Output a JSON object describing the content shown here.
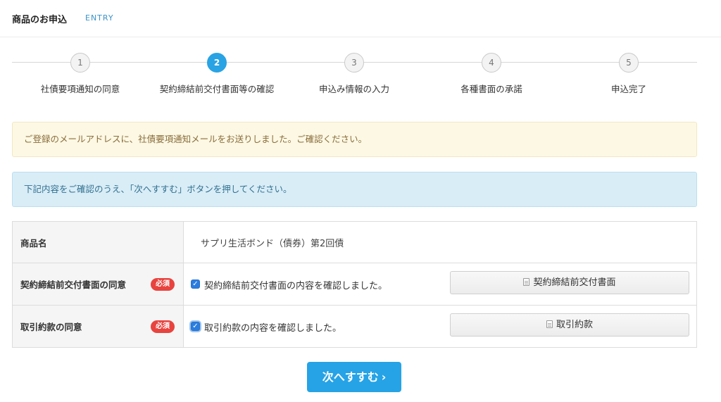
{
  "header": {
    "title": "商品のお申込",
    "subtitle": "ENTRY"
  },
  "steps": [
    {
      "number": "1",
      "label": "社債要項通知の同意",
      "state": "done"
    },
    {
      "number": "2",
      "label": "契約締結前交付書面等の確認",
      "state": "active"
    },
    {
      "number": "3",
      "label": "申込み情報の入力",
      "state": "pending"
    },
    {
      "number": "4",
      "label": "各種書面の承諾",
      "state": "pending"
    },
    {
      "number": "5",
      "label": "申込完了",
      "state": "pending"
    }
  ],
  "alerts": {
    "warning": "ご登録のメールアドレスに、社債要項通知メールをお送りしました。ご確認ください。",
    "info": "下記内容をご確認のうえ、「次へすすむ」ボタンを押してください。"
  },
  "form": {
    "product": {
      "label": "商品名",
      "value": "サプリ生活ボンド（債券）第2回債"
    },
    "pre_contract": {
      "label": "契約締結前交付書面の同意",
      "badge": "必須",
      "checkbox_label": "契約締結前交付書面の内容を確認しました。",
      "checked": true,
      "document_button": "契約締結前交付書面"
    },
    "terms": {
      "label": "取引約款の同意",
      "badge": "必須",
      "checkbox_label": "取引約款の内容を確認しました。",
      "checked": true,
      "document_button": "取引約款"
    }
  },
  "next_button": {
    "label": "次へすすむ",
    "icon": "chevron-right-icon"
  },
  "colors": {
    "accent": "#29a3e3",
    "required_badge": "#e8433e",
    "warning_bg": "#fcf8e4",
    "info_bg": "#d9edf7"
  }
}
